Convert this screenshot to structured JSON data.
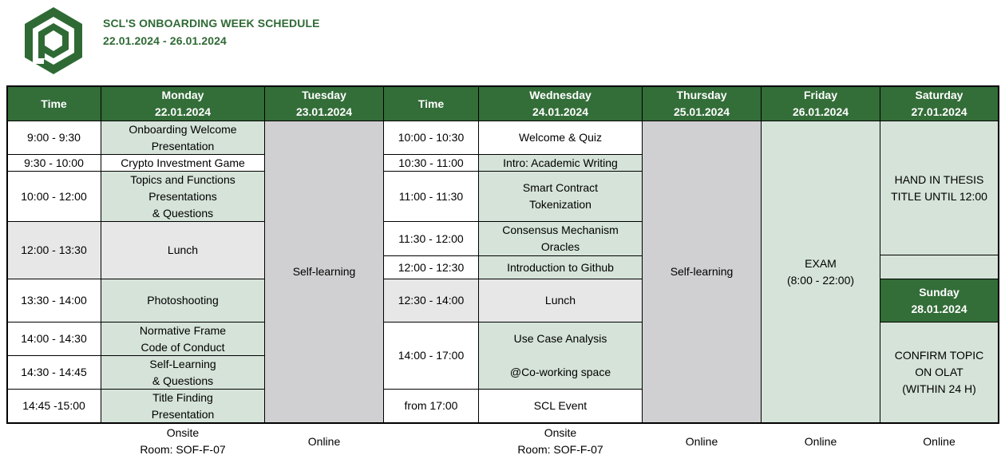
{
  "header": {
    "title": "SCL'S ONBOARDING WEEK SCHEDULE",
    "dates": "22.01.2024 - 26.01.2024",
    "accent_color": "#2f6a35",
    "logo_icon": "hexagon-logo-icon"
  },
  "columns": {
    "time1": "Time",
    "monday": "Monday\n22.01.2024",
    "tuesday": "Tuesday\n23.01.2024",
    "time2": "Time",
    "wednesday": "Wednesday\n24.01.2024",
    "thursday": "Thursday\n25.01.2024",
    "friday": "Friday\n26.01.2024",
    "saturday": "Saturday\n27.01.2024",
    "sunday": "Sunday\n28.01.2024"
  },
  "monday_times": [
    "9:00 - 9:30",
    "9:30 - 10:00",
    "10:00 - 12:00",
    "12:00 - 13:30",
    "13:30 - 14:00",
    "14:00 - 14:30",
    "14:30 - 14:45",
    "14:45 -15:00"
  ],
  "monday_events": [
    "Onboarding Welcome\nPresentation",
    "Crypto Investment Game",
    "Topics and Functions\nPresentations\n& Questions",
    "Lunch",
    "Photoshooting",
    "Normative Frame\nCode of Conduct",
    "Self-Learning\n& Questions",
    "Title Finding\nPresentation"
  ],
  "tuesday": "Self-learning",
  "wednesday_times": [
    "10:00 - 10:30",
    "10:30 - 11:00",
    "11:00 - 11:30",
    "11:30 - 12:00",
    "12:00 - 12:30",
    "12:30 - 14:00",
    "14:00 - 17:00",
    "from 17:00"
  ],
  "wednesday_events": [
    "Welcome & Quiz",
    "Intro: Academic Writing",
    "Smart Contract\nTokenization",
    "Consensus Mechanism\nOracles",
    "Introduction to Github",
    "Lunch",
    "Use Case Analysis\n\n@Co-working space",
    "SCL Event"
  ],
  "thursday": "Self-learning",
  "friday": "EXAM\n(8:00 - 22:00)",
  "saturday": "HAND IN THESIS\nTITLE UNTIL 12:00",
  "sunday": "CONFIRM TOPIC\nON OLAT\n(WITHIN 24 H)",
  "footer": {
    "monday": "Onsite\nRoom: SOF-F-07",
    "tuesday": "Online",
    "wednesday": "Onsite\nRoom: SOF-F-07",
    "thursday": "Online",
    "friday": "Online",
    "saturday": "Online"
  }
}
